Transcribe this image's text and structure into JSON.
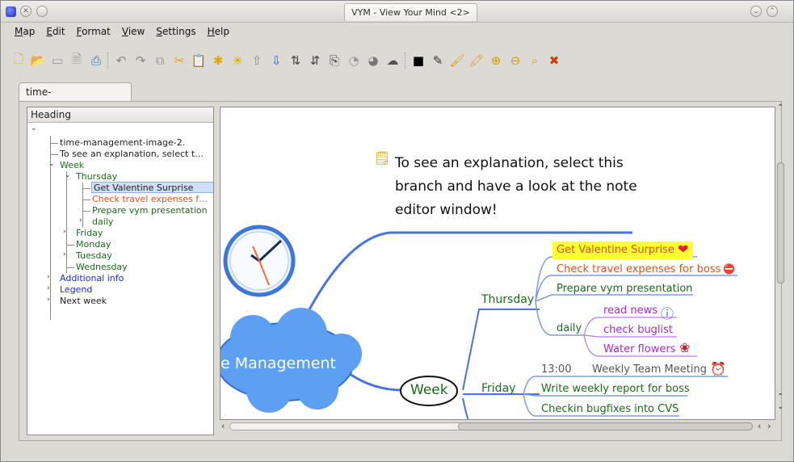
{
  "window": {
    "title": "VYM - View Your Mind <2>"
  },
  "menu": [
    "Map",
    "Edit",
    "Format",
    "View",
    "Settings",
    "Help"
  ],
  "file_tab": "time-management.vym",
  "tree": {
    "header": "Heading",
    "rows": [
      {
        "label": "time-management-image-2.",
        "color": "#111"
      },
      {
        "label": "To see an explanation, select t…",
        "color": "#111"
      },
      {
        "label": "Week",
        "color": "#1b6b1b"
      },
      {
        "label": "Thursday",
        "color": "#1b6b1b"
      },
      {
        "label": "Get Valentine Surprise",
        "color": "#111"
      },
      {
        "label": "Check travel expenses f…",
        "color": "#e0531c"
      },
      {
        "label": "Prepare vym presentation",
        "color": "#1b6b1b"
      },
      {
        "label": "daily",
        "color": "#1b6b1b"
      },
      {
        "label": "Friday",
        "color": "#1b6b1b"
      },
      {
        "label": "Monday",
        "color": "#1b6b1b"
      },
      {
        "label": "Tuesday",
        "color": "#1b6b1b"
      },
      {
        "label": "Wednesday",
        "color": "#1b6b1b"
      },
      {
        "label": "Additional info",
        "color": "#1a2bd8"
      },
      {
        "label": "Legend",
        "color": "#1a2bd8"
      },
      {
        "label": "Next week",
        "color": "#111"
      }
    ]
  },
  "map": {
    "note_text": "To see an explanation, select this branch and have a look at the note editor window!",
    "center_label": "e Management",
    "week": "Week",
    "thursday": "Thursday",
    "friday": "Friday",
    "daily": "daily",
    "get_valentine": "Get Valentine Surprise",
    "check_travel": "Check travel expenses for boss",
    "prepare_vym": "Prepare vym presentation",
    "read_news": "read news",
    "check_buglist": "check buglist",
    "water_flowers": "Water flowers",
    "time_1300": "13:00",
    "weekly_meeting": "Weekly Team Meeting",
    "write_report": "Write weekly report for boss",
    "checkin": "Checkin bugfixes into CVS"
  },
  "colors": {
    "accent": "#5b7fe8",
    "highlight": "#ffff33",
    "green": "#1b6b1b",
    "orange": "#e0531c",
    "purple": "#a52bd4",
    "cloud": "#5d9ff0"
  }
}
